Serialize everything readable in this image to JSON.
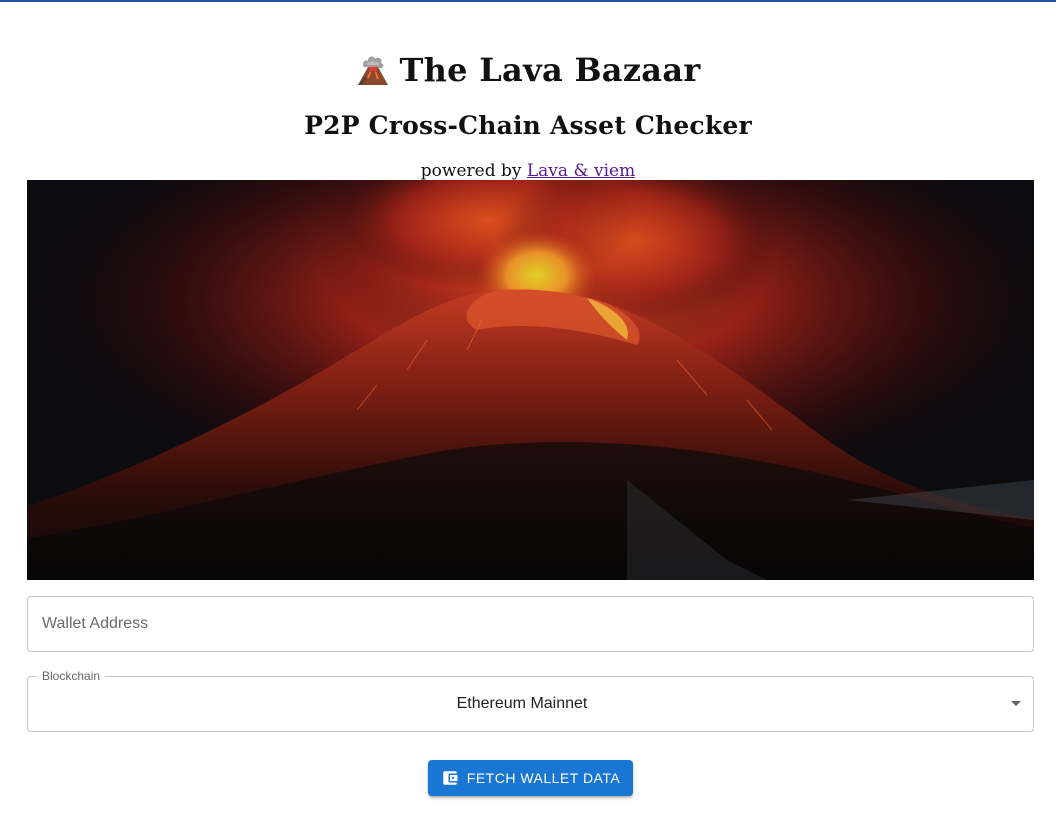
{
  "header": {
    "emoji": "🌋",
    "title": "The Lava Bazaar",
    "subtitle": "P2P Cross-Chain Asset Checker",
    "powered_prefix": "powered by ",
    "powered_link": "Lava & viem"
  },
  "hero": {
    "image": "volcano-eruption-night"
  },
  "form": {
    "wallet_placeholder": "Wallet Address",
    "blockchain_label": "Blockchain",
    "blockchain_value": "Ethereum Mainnet",
    "fetch_label": "FETCH WALLET DATA"
  },
  "colors": {
    "accent": "#1976d2",
    "top_bar": "#1f4fa8",
    "link": "#551a8b"
  },
  "icons": {
    "title_emoji": "volcano-icon",
    "button_icon": "wallet-icon",
    "dropdown": "caret-down-icon"
  }
}
